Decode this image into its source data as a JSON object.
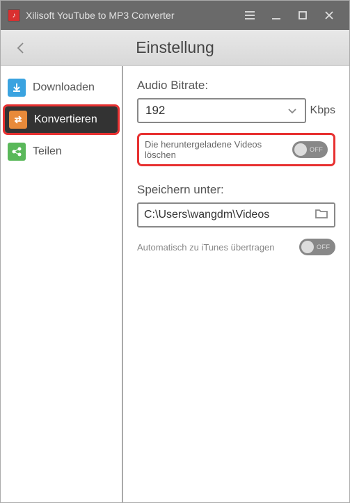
{
  "titlebar": {
    "app_name": "Xilisoft YouTube to MP3 Converter"
  },
  "header": {
    "page_title": "Einstellung"
  },
  "sidebar": {
    "items": [
      {
        "label": "Downloaden"
      },
      {
        "label": "Konvertieren"
      },
      {
        "label": "Teilen"
      }
    ]
  },
  "main": {
    "bitrate_label": "Audio Bitrate:",
    "bitrate_value": "192",
    "bitrate_unit": "Kbps",
    "delete_downloaded_label": "Die heruntergeladene Videos löschen",
    "delete_downloaded_state": "OFF",
    "save_label": "Speichern unter:",
    "save_path": "C:\\Users\\wangdm\\Videos",
    "itunes_label": "Automatisch zu iTunes übertragen",
    "itunes_state": "OFF"
  }
}
